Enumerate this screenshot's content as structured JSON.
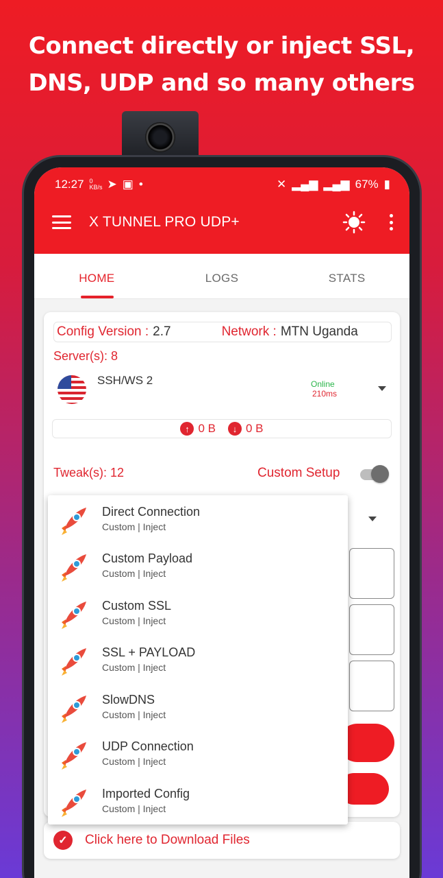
{
  "headline": {
    "line1": "Connect directly or inject SSL,",
    "line2": "DNS, UDP and so many others"
  },
  "status_bar": {
    "time": "12:27",
    "net_speed": "0 KB/s",
    "battery": "67%"
  },
  "app": {
    "title": "X TUNNEL PRO UDP+",
    "accent_color": "#ee1c24"
  },
  "tabs": [
    {
      "label": "HOME",
      "active": true
    },
    {
      "label": "LOGS",
      "active": false
    },
    {
      "label": "STATS",
      "active": false
    }
  ],
  "config": {
    "version_label": "Config Version :",
    "version_value": "2.7",
    "network_label": "Network :",
    "network_value": "MTN Uganda"
  },
  "servers": {
    "label": "Server(s): 8",
    "selected": "SSH/WS 2",
    "status": "Online",
    "ping": "210ms",
    "flag_icon": "us-flag-icon"
  },
  "traffic": {
    "upload": "0 B",
    "download": "0 B"
  },
  "tweaks": {
    "label": "Tweak(s): 12",
    "custom_setup_label": "Custom Setup",
    "custom_setup_on": false
  },
  "dropdown_items": [
    {
      "title": "Direct Connection",
      "subtitle": "Custom | Inject"
    },
    {
      "title": "Custom Payload",
      "subtitle": "Custom | Inject"
    },
    {
      "title": "Custom SSL",
      "subtitle": "Custom | Inject"
    },
    {
      "title": "SSL + PAYLOAD",
      "subtitle": "Custom | Inject"
    },
    {
      "title": "SlowDNS",
      "subtitle": "Custom | Inject"
    },
    {
      "title": "UDP Connection",
      "subtitle": "Custom | Inject"
    },
    {
      "title": "Imported Config",
      "subtitle": "Custom | Inject"
    }
  ],
  "download_banner": {
    "text": "Click here to Download Files"
  }
}
